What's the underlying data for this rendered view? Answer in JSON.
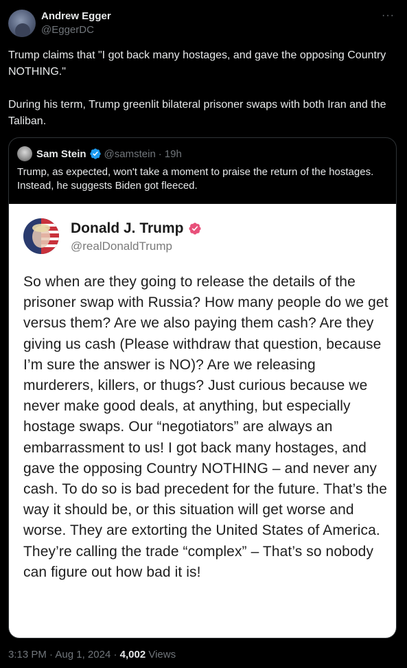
{
  "author": {
    "name": "Andrew Egger",
    "handle": "@EggerDC",
    "more": "···"
  },
  "tweet": {
    "paragraphs": [
      "Trump claims that \"I got back many hostages, and gave the opposing Country NOTHING.\"",
      "During his term, Trump greenlit bilateral prisoner swaps with both Iran and the Taliban."
    ]
  },
  "quote": {
    "name": "Sam Stein",
    "handle": "@samstein",
    "separator": "·",
    "time": "19h",
    "text": "Trump, as expected, won't take a moment to praise the return of the hostages. Instead, he suggests Biden got fleeced."
  },
  "truth_post": {
    "name": "Donald J. Trump",
    "handle": "@realDonaldTrump",
    "body": "So when are they going to release the details of the prisoner swap with Russia? How many people do we get versus them? Are we also paying them cash? Are they giving us cash (Please withdraw that question, because I’m sure the answer is NO)? Are we releasing murderers, killers, or thugs? Just curious because we never make good deals, at anything, but especially hostage swaps. Our “negotiators” are always an embarrassment to us! I got back many hostages, and gave the opposing Country NOTHING – and never any cash. To do so is bad precedent for the future. That’s the way it should be, or this situation will get worse and worse. They are extorting the United States of America. They’re calling the trade “complex” – That’s so nobody can figure out how bad it is!"
  },
  "meta": {
    "time": "3:13 PM",
    "dot1": "·",
    "date": "Aug 1, 2024",
    "dot2": "·",
    "views_count": "4,002",
    "views_label": "Views"
  },
  "colors": {
    "background": "#000000",
    "text": "#e7e9ea",
    "secondary": "#71767b",
    "verified_blue": "#1d9bf0",
    "truth_verified": "#e8507a"
  },
  "icons": [
    "more-icon",
    "verified-icon",
    "truth-verified-icon"
  ]
}
